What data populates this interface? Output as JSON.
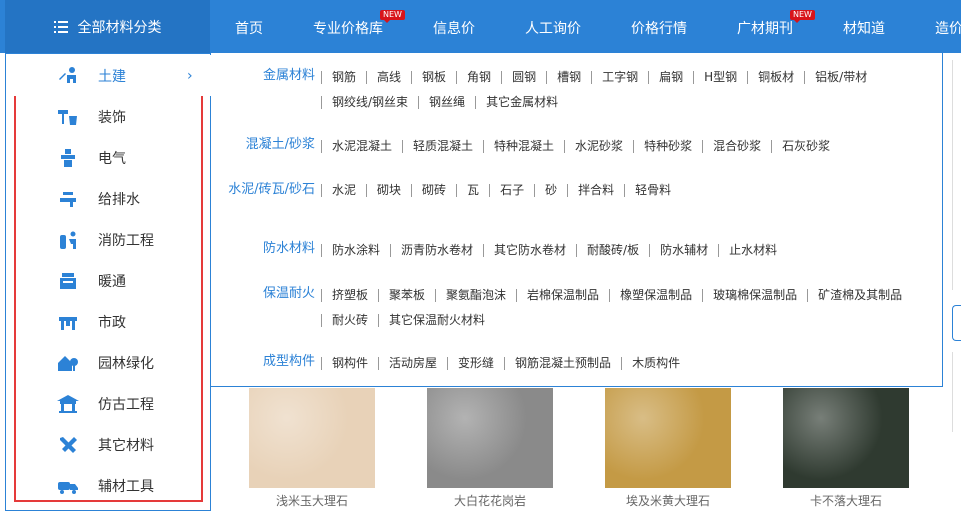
{
  "nav": {
    "all_categories": "全部材料分类",
    "items": [
      {
        "label": "首页"
      },
      {
        "label": "专业价格库",
        "badge": "NEW"
      },
      {
        "label": "信息价"
      },
      {
        "label": "人工询价"
      },
      {
        "label": "价格行情"
      },
      {
        "label": "广材期刊",
        "badge": "NEW"
      },
      {
        "label": "材知道"
      },
      {
        "label": "造价"
      }
    ]
  },
  "sidebar": {
    "items": [
      {
        "label": "土建",
        "icon": "worker-icon",
        "active": true
      },
      {
        "label": "装饰",
        "icon": "paint-icon"
      },
      {
        "label": "电气",
        "icon": "electric-icon"
      },
      {
        "label": "给排水",
        "icon": "faucet-icon"
      },
      {
        "label": "消防工程",
        "icon": "extinguisher-icon"
      },
      {
        "label": "暖通",
        "icon": "hvac-icon"
      },
      {
        "label": "市政",
        "icon": "municipal-icon"
      },
      {
        "label": "园林绿化",
        "icon": "house-tree-icon"
      },
      {
        "label": "仿古工程",
        "icon": "pavilion-icon"
      },
      {
        "label": "其它材料",
        "icon": "tools-icon"
      },
      {
        "label": "辅材工具",
        "icon": "truck-icon"
      }
    ]
  },
  "panel": {
    "groups": [
      {
        "title": "金属材料",
        "items": [
          "钢筋",
          "高线",
          "钢板",
          "角钢",
          "圆钢",
          "槽钢",
          "工字钢",
          "扁钢",
          "H型钢",
          "铜板材",
          "铝板/带材",
          "钢绞线/钢丝束",
          "钢丝绳",
          "其它金属材料"
        ]
      },
      {
        "title": "混凝土/砂浆",
        "items": [
          "水泥混凝土",
          "轻质混凝土",
          "特种混凝土",
          "水泥砂浆",
          "特种砂浆",
          "混合砂浆",
          "石灰砂浆"
        ]
      },
      {
        "title": "水泥/砖瓦/砂石",
        "items": [
          "水泥",
          "砌块",
          "砌砖",
          "瓦",
          "石子",
          "砂",
          "拌合料",
          "轻骨料"
        ]
      },
      {
        "title": "防水材料",
        "items": [
          "防水涂料",
          "沥青防水卷材",
          "其它防水卷材",
          "耐酸砖/板",
          "防水辅材",
          "止水材料"
        ]
      },
      {
        "title": "保温耐火",
        "items": [
          "挤塑板",
          "聚苯板",
          "聚氨酯泡沫",
          "岩棉保温制品",
          "橡塑保温制品",
          "玻璃棉保温制品",
          "矿渣棉及其制品",
          "耐火砖",
          "其它保温耐火材料"
        ]
      },
      {
        "title": "成型构件",
        "items": [
          "钢构件",
          "活动房屋",
          "变形缝",
          "钢筋混凝土预制品",
          "木质构件"
        ]
      }
    ]
  },
  "thumbs": [
    {
      "caption": "浅米玉大理石",
      "color": "#e8d2b8"
    },
    {
      "caption": "大白花花岗岩",
      "color": "#8a8a8a"
    },
    {
      "caption": "埃及米黄大理石",
      "color": "#c49a45"
    },
    {
      "caption": "卡不落大理石",
      "color": "#2f3a30"
    }
  ],
  "colors": {
    "brand": "#2c82d6",
    "highlight": "#e53a3a",
    "badge": "#d8141a"
  }
}
